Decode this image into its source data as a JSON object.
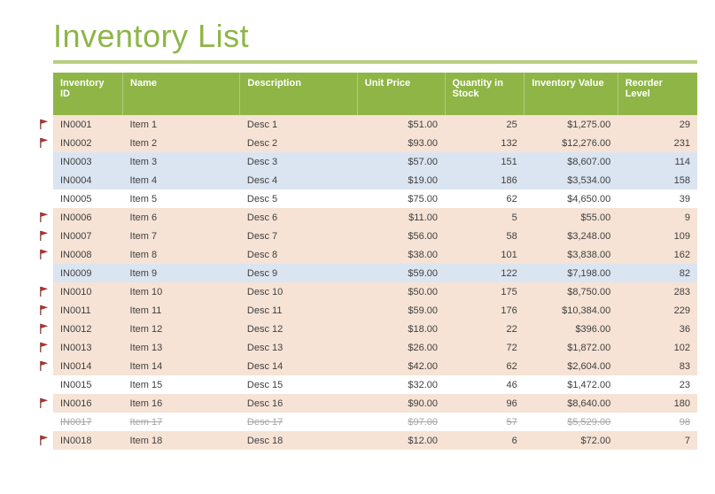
{
  "title": "Inventory List",
  "columns": [
    "Inventory ID",
    "Name",
    "Description",
    "Unit Price",
    "Quantity in Stock",
    "Inventory Value",
    "Reorder Level"
  ],
  "rows": [
    {
      "flag": true,
      "strike": false,
      "shade": "peach",
      "id": "IN0001",
      "name": "Item 1",
      "desc": "Desc 1",
      "unit_price": "$51.00",
      "qty": "25",
      "value": "$1,275.00",
      "reorder": "29"
    },
    {
      "flag": true,
      "strike": false,
      "shade": "peach",
      "id": "IN0002",
      "name": "Item 2",
      "desc": "Desc 2",
      "unit_price": "$93.00",
      "qty": "132",
      "value": "$12,276.00",
      "reorder": "231"
    },
    {
      "flag": false,
      "strike": false,
      "shade": "blue",
      "id": "IN0003",
      "name": "Item 3",
      "desc": "Desc 3",
      "unit_price": "$57.00",
      "qty": "151",
      "value": "$8,607.00",
      "reorder": "114"
    },
    {
      "flag": false,
      "strike": false,
      "shade": "blue",
      "id": "IN0004",
      "name": "Item 4",
      "desc": "Desc 4",
      "unit_price": "$19.00",
      "qty": "186",
      "value": "$3,534.00",
      "reorder": "158"
    },
    {
      "flag": false,
      "strike": false,
      "shade": "white",
      "id": "IN0005",
      "name": "Item 5",
      "desc": "Desc 5",
      "unit_price": "$75.00",
      "qty": "62",
      "value": "$4,650.00",
      "reorder": "39"
    },
    {
      "flag": true,
      "strike": false,
      "shade": "peach",
      "id": "IN0006",
      "name": "Item 6",
      "desc": "Desc 6",
      "unit_price": "$11.00",
      "qty": "5",
      "value": "$55.00",
      "reorder": "9"
    },
    {
      "flag": true,
      "strike": false,
      "shade": "peach",
      "id": "IN0007",
      "name": "Item 7",
      "desc": "Desc 7",
      "unit_price": "$56.00",
      "qty": "58",
      "value": "$3,248.00",
      "reorder": "109"
    },
    {
      "flag": true,
      "strike": false,
      "shade": "peach",
      "id": "IN0008",
      "name": "Item 8",
      "desc": "Desc 8",
      "unit_price": "$38.00",
      "qty": "101",
      "value": "$3,838.00",
      "reorder": "162"
    },
    {
      "flag": false,
      "strike": false,
      "shade": "blue",
      "id": "IN0009",
      "name": "Item 9",
      "desc": "Desc 9",
      "unit_price": "$59.00",
      "qty": "122",
      "value": "$7,198.00",
      "reorder": "82"
    },
    {
      "flag": true,
      "strike": false,
      "shade": "peach",
      "id": "IN0010",
      "name": "Item 10",
      "desc": "Desc 10",
      "unit_price": "$50.00",
      "qty": "175",
      "value": "$8,750.00",
      "reorder": "283"
    },
    {
      "flag": true,
      "strike": false,
      "shade": "peach",
      "id": "IN0011",
      "name": "Item 11",
      "desc": "Desc 11",
      "unit_price": "$59.00",
      "qty": "176",
      "value": "$10,384.00",
      "reorder": "229"
    },
    {
      "flag": true,
      "strike": false,
      "shade": "peach",
      "id": "IN0012",
      "name": "Item 12",
      "desc": "Desc 12",
      "unit_price": "$18.00",
      "qty": "22",
      "value": "$396.00",
      "reorder": "36"
    },
    {
      "flag": true,
      "strike": false,
      "shade": "peach",
      "id": "IN0013",
      "name": "Item 13",
      "desc": "Desc 13",
      "unit_price": "$26.00",
      "qty": "72",
      "value": "$1,872.00",
      "reorder": "102"
    },
    {
      "flag": true,
      "strike": false,
      "shade": "peach",
      "id": "IN0014",
      "name": "Item 14",
      "desc": "Desc 14",
      "unit_price": "$42.00",
      "qty": "62",
      "value": "$2,604.00",
      "reorder": "83"
    },
    {
      "flag": false,
      "strike": false,
      "shade": "white",
      "id": "IN0015",
      "name": "Item 15",
      "desc": "Desc 15",
      "unit_price": "$32.00",
      "qty": "46",
      "value": "$1,472.00",
      "reorder": "23"
    },
    {
      "flag": true,
      "strike": false,
      "shade": "peach",
      "id": "IN0016",
      "name": "Item 16",
      "desc": "Desc 16",
      "unit_price": "$90.00",
      "qty": "96",
      "value": "$8,640.00",
      "reorder": "180"
    },
    {
      "flag": false,
      "strike": true,
      "shade": "white",
      "id": "IN0017",
      "name": "Item 17",
      "desc": "Desc 17",
      "unit_price": "$97.00",
      "qty": "57",
      "value": "$5,529.00",
      "reorder": "98"
    },
    {
      "flag": true,
      "strike": false,
      "shade": "peach",
      "id": "IN0018",
      "name": "Item 18",
      "desc": "Desc 18",
      "unit_price": "$12.00",
      "qty": "6",
      "value": "$72.00",
      "reorder": "7"
    }
  ]
}
